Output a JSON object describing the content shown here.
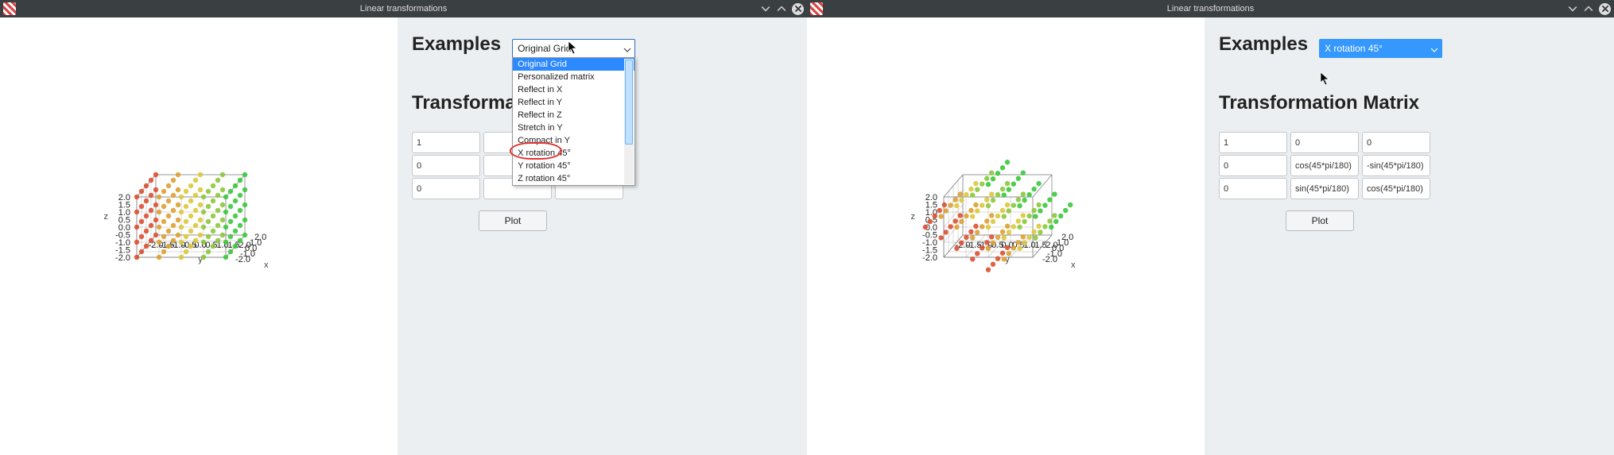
{
  "window": {
    "title": "Linear transformations"
  },
  "left": {
    "examples_label": "Examples",
    "select_display": "Original Grid",
    "options": {
      "o0": "Original Grid",
      "o1": "Personalized matrix",
      "o2": "Reflect in X",
      "o3": "Reflect in Y",
      "o4": "Reflect in Z",
      "o5": "Stretch in Y",
      "o6": "Compact in Y",
      "o7": "X rotation 45°",
      "o8": "Y rotation 45°",
      "o9": "Z rotation 45°"
    },
    "matrix_heading_partial": "Transforma",
    "matrix": {
      "r0c0": "1",
      "r0c1": "",
      "r0c2": "",
      "r1c0": "0",
      "r1c1": "",
      "r1c2": "",
      "r2c0": "0",
      "r2c1": "",
      "r2c2": ""
    },
    "plot_btn": "Plot",
    "plot": {
      "z_label": "z",
      "y_label": "y",
      "x_label": "x",
      "z_ticks": [
        "2.0",
        "1.5",
        "1.0",
        "0.5",
        "0.0",
        "-0.5",
        "-1.0",
        "-1.5",
        "-2.0"
      ],
      "y_ticks": [
        "-2.0",
        "-1.5",
        "-1.0",
        "-0.5",
        "0.0",
        "0.5",
        "1.0",
        "1.5",
        "2.0"
      ],
      "x_ticks": [
        "-2.0",
        "-1.0",
        "0.0",
        "1.0",
        "2.0"
      ]
    }
  },
  "right": {
    "examples_label": "Examples",
    "select_display": "X rotation 45°",
    "matrix_heading": "Transformation Matrix",
    "matrix": {
      "r0c0": "1",
      "r0c1": "0",
      "r0c2": "0",
      "r1c0": "0",
      "r1c1": "cos(45*pi/180)",
      "r1c2": "-sin(45*pi/180)",
      "r2c0": "0",
      "r2c1": "sin(45*pi/180)",
      "r2c2": "cos(45*pi/180)"
    },
    "plot_btn": "Plot",
    "plot": {
      "z_label": "z",
      "y_label": "y",
      "x_label": "x",
      "z_ticks": [
        "2.0",
        "1.5",
        "1.0",
        "0.5",
        "0.0",
        "-0.5",
        "-1.0",
        "-1.5",
        "-2.0"
      ],
      "y_ticks": [
        "-2.0",
        "-1.5",
        "-1.0",
        "-0.5",
        "0.0",
        "0.5",
        "1.0",
        "1.5",
        "2.0"
      ],
      "x_ticks": [
        "-2.0",
        "-1.0",
        "0.0",
        "1.0",
        "2.0"
      ]
    }
  },
  "chart_data": [
    {
      "type": "scatter",
      "title": "Original Grid",
      "xlabel": "y",
      "ylabel": "z",
      "zlabel": "x",
      "ylim": [
        -2,
        2
      ],
      "xlim": [
        -2,
        2
      ],
      "zlim": [
        -2,
        2
      ],
      "description": "5x5x5 integer lattice points from -2 to 2 on each axis (125 points), color ramp red→yellow→green along y"
    },
    {
      "type": "scatter",
      "title": "X rotation 45°",
      "xlabel": "y",
      "ylabel": "z",
      "zlabel": "x",
      "ylim": [
        -2,
        2
      ],
      "xlim": [
        -2,
        2
      ],
      "zlim": [
        -2,
        2
      ],
      "description": "Same 5x5x5 lattice rotated 45° about the X axis (points sheared diagonally), color ramp red→yellow→green along original y"
    }
  ]
}
